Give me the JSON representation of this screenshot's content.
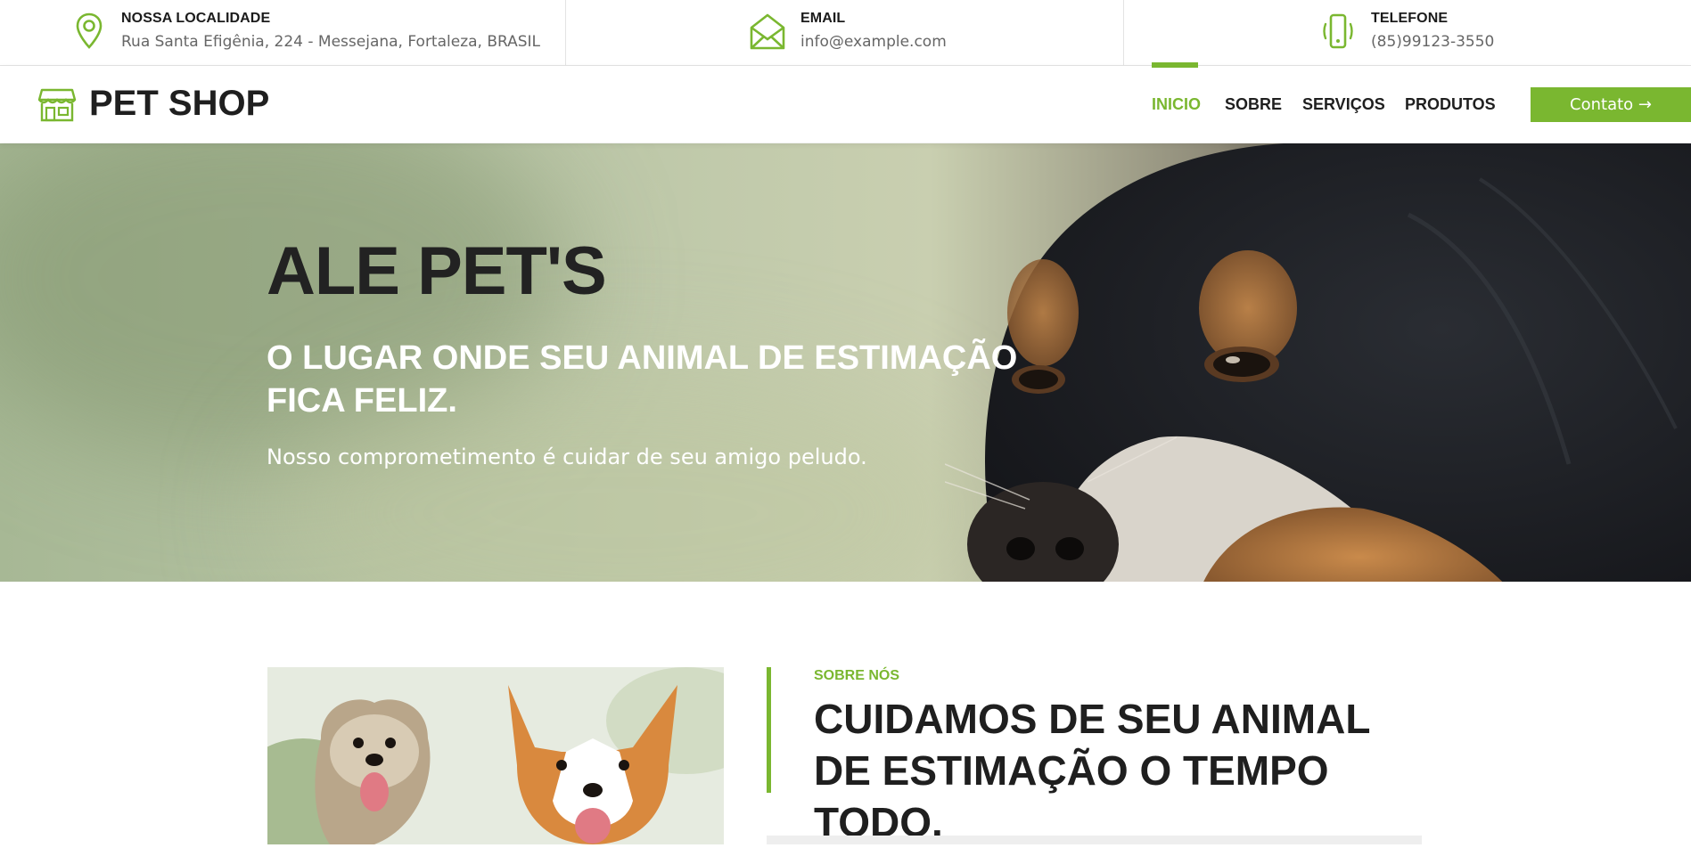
{
  "topbar": {
    "location": {
      "icon": "map-pin-icon",
      "title": "NOSSA LOCALIDADE",
      "text": "Rua Santa Efigênia, 224 - Messejana, Fortaleza, BRASIL"
    },
    "email": {
      "icon": "envelope-icon",
      "title": "EMAIL",
      "text": "info@example.com"
    },
    "phone": {
      "icon": "phone-vibrate-icon",
      "title": "TELEFONE",
      "text": "(85)99123-3550"
    }
  },
  "navbar": {
    "logo_icon": "storefront-icon",
    "logo_text": "PET SHOP",
    "items": [
      {
        "label": "INICIO",
        "active": true
      },
      {
        "label": "SOBRE",
        "active": false
      },
      {
        "label": "SERVIÇOS",
        "active": false
      },
      {
        "label": "PRODUTOS",
        "active": false
      }
    ],
    "contact_button": "Contato →"
  },
  "hero": {
    "title": "ALE PET'S",
    "subtitle": "O LUGAR ONDE SEU ANIMAL DE ESTIMAÇÃO FICA FELIZ.",
    "description": "Nosso comprometimento é cuidar de seu amigo peludo."
  },
  "about": {
    "eyebrow": "SOBRE NÓS",
    "title": "CUIDAMOS DE SEU ANIMAL DE ESTIMAÇÃO O TEMPO TODO."
  },
  "colors": {
    "accent": "#7ab730",
    "dark_text": "#1f1f1f",
    "muted_text": "#666666"
  }
}
